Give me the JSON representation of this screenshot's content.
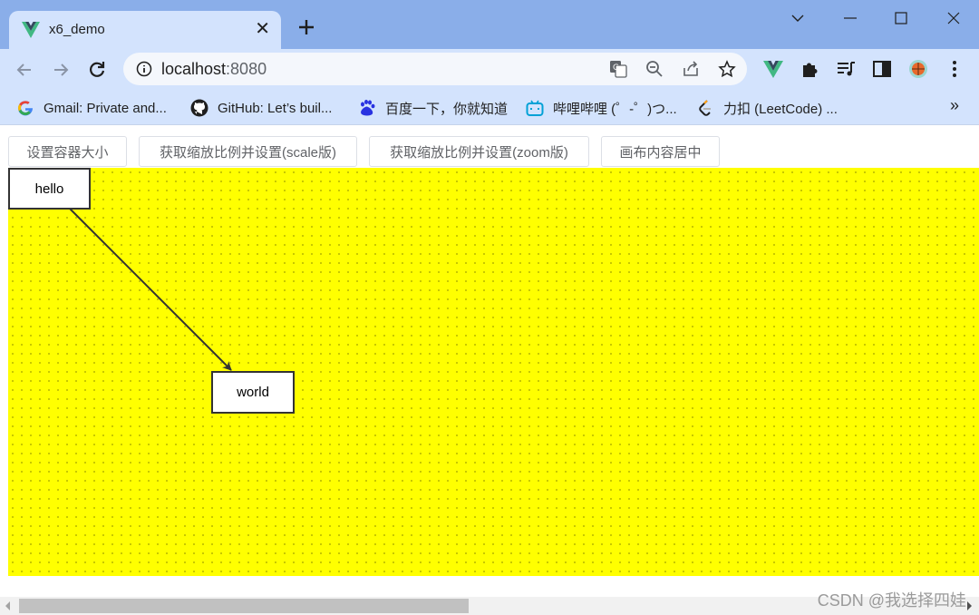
{
  "browser": {
    "tab": {
      "title": "x6_demo",
      "close_glyph": "✕",
      "favicon": "vue-logo-icon"
    },
    "new_tab_glyph": "+",
    "address": {
      "host": "localhost",
      "port": ":8080"
    },
    "bookmarks": [
      {
        "label": "Gmail: Private and...",
        "icon": "google-icon"
      },
      {
        "label": "GitHub: Let’s buil...",
        "icon": "github-icon"
      },
      {
        "label": "百度一下，你就知道",
        "icon": "baidu-icon"
      },
      {
        "label": "哔哩哔哩 (゜-゜)つ...",
        "icon": "bilibili-icon"
      },
      {
        "label": "力扣 (LeetCode) ...",
        "icon": "leetcode-icon"
      }
    ],
    "bookmarks_more": "»"
  },
  "page": {
    "buttons": [
      {
        "label": "设置容器大小"
      },
      {
        "label": "获取缩放比例并设置(scale版)"
      },
      {
        "label": "获取缩放比例并设置(zoom版)"
      },
      {
        "label": "画布内容居中"
      }
    ],
    "graph": {
      "background": "#ffff00",
      "nodes": [
        {
          "id": "hello",
          "label": "hello"
        },
        {
          "id": "world",
          "label": "world"
        }
      ],
      "edges": [
        {
          "source": "hello",
          "target": "world"
        }
      ]
    },
    "watermark": "CSDN @我选择四娃"
  },
  "colors": {
    "accent": "#8aaee9",
    "toolbar": "#d3e3fd",
    "canvas": "#ffff00"
  }
}
